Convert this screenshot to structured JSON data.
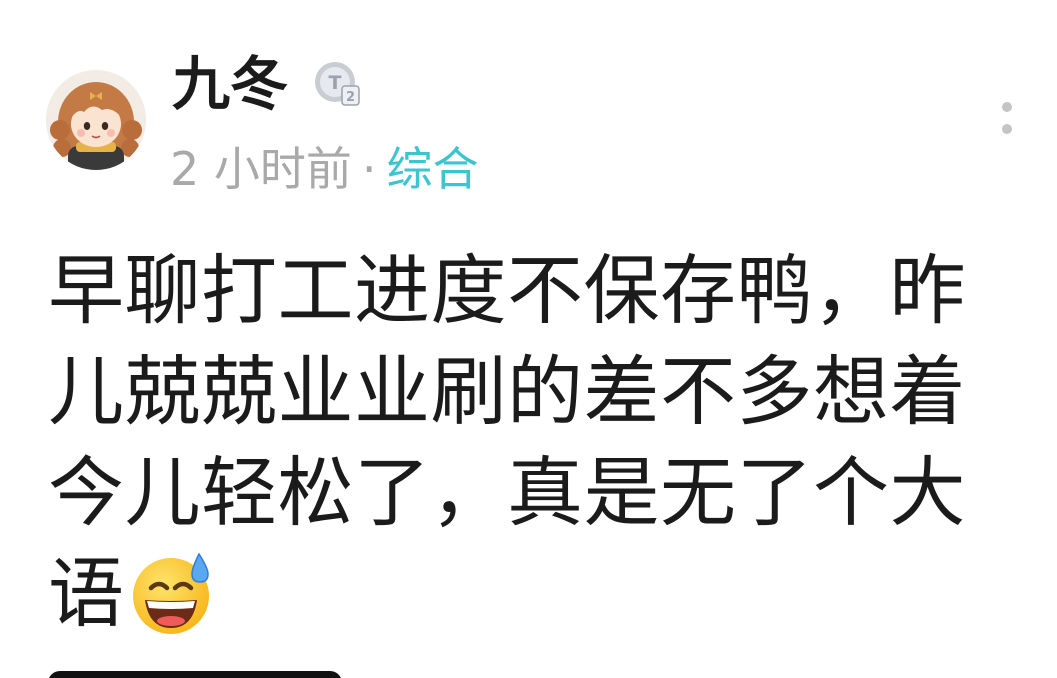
{
  "post": {
    "author": {
      "name": "九冬",
      "avatar_icon": "girl-avatar-icon",
      "badge_icon": "level-badge-icon",
      "badge_text": "T2"
    },
    "meta": {
      "time": "2 小时前",
      "separator": "·",
      "category": "综合"
    },
    "more_icon": "more-vertical-icon",
    "content": {
      "text": "早聊打工进度不保存鸭，昨儿兢兢业业刷的差不多想着今儿轻松了，真是无了个大语",
      "emoji_icon": "grinning-sweat-emoji"
    }
  },
  "colors": {
    "text": "#1b1b1b",
    "muted": "#a9a9a9",
    "category": "#3cc5cf",
    "more_dots": "#c4c4c4"
  }
}
